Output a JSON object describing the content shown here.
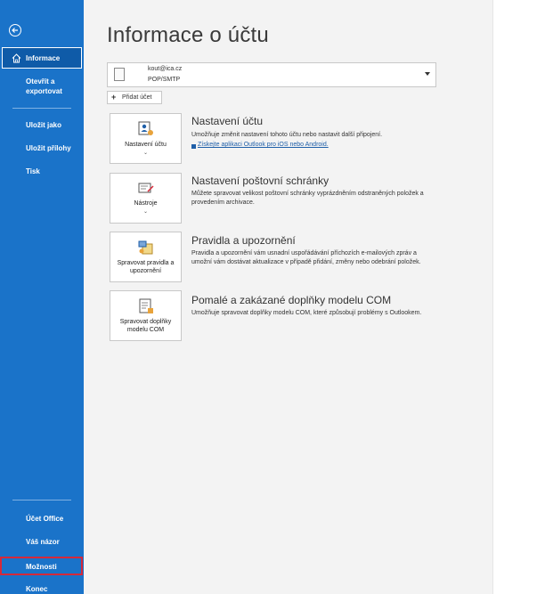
{
  "sidebar": {
    "items": [
      {
        "label": "Informace"
      },
      {
        "label": "Otevřít a exportovat"
      },
      {
        "label": "Uložit jako"
      },
      {
        "label": "Uložit přílohy"
      },
      {
        "label": "Tisk"
      }
    ],
    "bottom_items": [
      {
        "label": "Účet Office"
      },
      {
        "label": "Váš názor"
      },
      {
        "label": "Možnosti"
      },
      {
        "label": "Konec"
      }
    ],
    "highlight_color": "#d6293a",
    "background_color": "#1a73c9"
  },
  "main": {
    "title": "Informace o účtu",
    "account": {
      "email": "kout@ica.cz",
      "type": "POP/SMTP"
    },
    "add_account_label": "Přidat účet",
    "sections": [
      {
        "tile_label": "Nastavení účtu",
        "heading": "Nastavení účtu",
        "description": "Umožňuje změnit nastavení tohoto účtu nebo nastavit další připojení.",
        "link": "Získejte aplikaci Outlook pro iOS nebo Android."
      },
      {
        "tile_label": "Nástroje",
        "heading": "Nastavení poštovní schránky",
        "description": "Můžete spravovat velikost poštovní schránky vyprázdněním odstraněných položek a provedením archivace."
      },
      {
        "tile_label": "Spravovat pravidla a upozornění",
        "heading": "Pravidla a upozornění",
        "description": "Pravidla a upozornění vám usnadní uspořádávání příchozích e-mailových zpráv a umožní vám dostávat aktualizace v případě přidání, změny nebo odebrání položek."
      },
      {
        "tile_label": "Spravovat doplňky modelu COM",
        "heading": "Pomalé a zakázané doplňky modelu COM",
        "description": "Umožňuje spravovat doplňky modelu COM, které způsobují problémy s Outlookem."
      }
    ]
  }
}
